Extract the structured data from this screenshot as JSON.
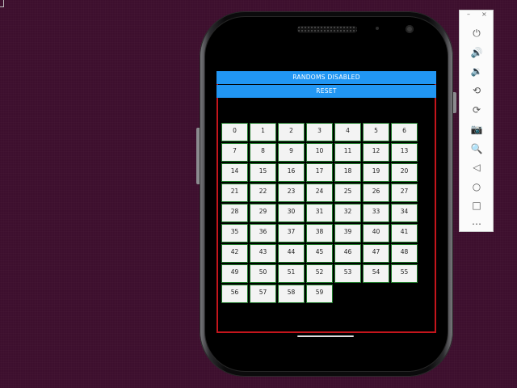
{
  "app": {
    "randoms_label": "RANDOMS DISABLED",
    "reset_label": "RESET",
    "cells": [
      "0",
      "1",
      "2",
      "3",
      "4",
      "5",
      "6",
      "7",
      "8",
      "9",
      "10",
      "11",
      "12",
      "13",
      "14",
      "15",
      "16",
      "17",
      "18",
      "19",
      "20",
      "21",
      "22",
      "23",
      "24",
      "25",
      "26",
      "27",
      "28",
      "29",
      "30",
      "31",
      "32",
      "33",
      "34",
      "35",
      "36",
      "37",
      "38",
      "39",
      "40",
      "41",
      "42",
      "43",
      "44",
      "45",
      "46",
      "47",
      "48",
      "49",
      "50",
      "51",
      "52",
      "53",
      "54",
      "55",
      "56",
      "57",
      "58",
      "59"
    ]
  },
  "emulator_toolbar": {
    "minimize_glyph": "–",
    "close_glyph": "×",
    "items": [
      {
        "name": "power-icon",
        "glyph": "⏻"
      },
      {
        "name": "volume-up-icon",
        "glyph": "🔊"
      },
      {
        "name": "volume-down-icon",
        "glyph": "🔉"
      },
      {
        "name": "rotate-left-icon",
        "glyph": "⟲"
      },
      {
        "name": "rotate-right-icon",
        "glyph": "⟳"
      },
      {
        "name": "camera-icon",
        "glyph": "📷"
      },
      {
        "name": "zoom-icon",
        "glyph": "🔍"
      },
      {
        "name": "back-icon",
        "glyph": "◁"
      },
      {
        "name": "home-icon",
        "glyph": "○"
      },
      {
        "name": "overview-icon",
        "glyph": "□"
      },
      {
        "name": "more-icon",
        "glyph": "⋯"
      }
    ]
  },
  "colors": {
    "desktop_bg": "#3d0f2e",
    "app_button": "#2196f3",
    "screen_border": "#c4151c",
    "cell_border": "#1f7a2a"
  }
}
